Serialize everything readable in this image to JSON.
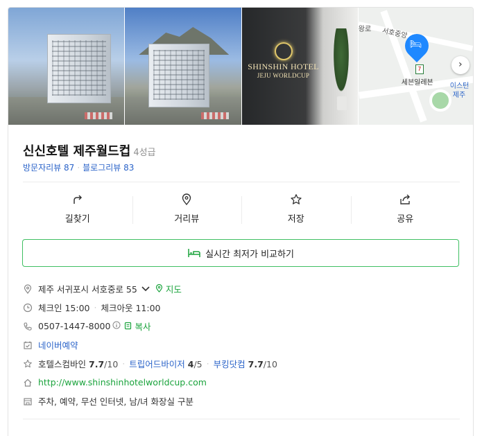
{
  "gallery": {
    "photos": [
      "exterior-photo-1",
      "exterior-photo-2",
      "lobby-photo",
      "map-thumbnail"
    ],
    "lobby_sign_line1": "SHINSHIN HOTEL",
    "lobby_sign_line2": "JEJU WORLDCUP",
    "map_labels": {
      "road_top_left": "왕로",
      "road_name": "서호중앙",
      "store": "세븐일레븐",
      "right_label": "이스턴",
      "right_label2": "제주"
    }
  },
  "header": {
    "title": "신신호텔 제주월드컵",
    "grade": "4성급"
  },
  "reviews": {
    "visitor_label": "방문자리뷰",
    "visitor_count": "87",
    "blog_label": "블로그리뷰",
    "blog_count": "83"
  },
  "actions": [
    {
      "icon": "directions-icon",
      "label": "길찾기"
    },
    {
      "icon": "street-view-icon",
      "label": "거리뷰"
    },
    {
      "icon": "star-icon",
      "label": "저장"
    },
    {
      "icon": "share-icon",
      "label": "공유"
    }
  ],
  "compare_button": "실시간 최저가 비교하기",
  "details": {
    "address": "제주 서귀포시 서호중로 55",
    "map_link": "지도",
    "checkin": "체크인 15:00",
    "checkout": "체크아웃 11:00",
    "phone": "0507-1447-8000",
    "copy_label": "복사",
    "booking": "네이버예약",
    "ratings": [
      {
        "site": "호텔스컴바인",
        "score": "7.7",
        "max": "/10"
      },
      {
        "site": "트립어드바이저",
        "score": "4",
        "max": "/5"
      },
      {
        "site": "부킹닷컴",
        "score": "7.7",
        "max": "/10"
      }
    ],
    "website": "http://www.shinshinhotelworldcup.com",
    "amenities": "주차, 예약, 무선 인터넷, 남/녀 화장실 구분"
  },
  "colors": {
    "accent_green": "#1aa33c",
    "link_blue": "#2b64c9",
    "border_green": "#3fbf62",
    "pin_blue": "#1e88ff"
  }
}
